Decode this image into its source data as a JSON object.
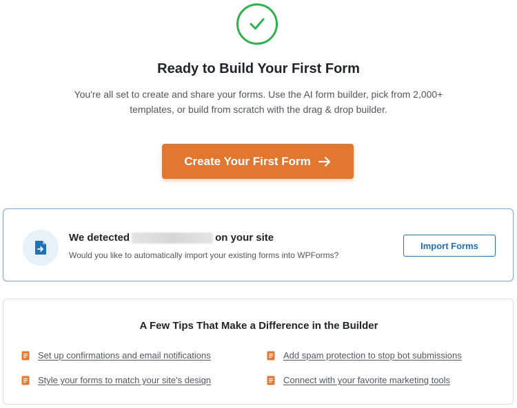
{
  "hero": {
    "icon": "checkmark-icon",
    "success_color": "#2bb24c",
    "title": "Ready to Build Your First Form",
    "subtitle": "You're all set to create and share your forms. Use the AI form builder, pick from 2,000+ templates, or build from scratch with the drag & drop builder.",
    "cta_label": "Create Your First Form",
    "cta_icon": "arrow-right-icon",
    "cta_color": "#e27730"
  },
  "import": {
    "icon": "import-file-icon",
    "heading_prefix": "We detected",
    "heading_suffix": "on your site",
    "question": "Would you like to automatically import your existing forms into WPForms?",
    "button_label": "Import Forms",
    "accent_color": "#2271b1"
  },
  "tips": {
    "title": "A Few Tips That Make a Difference in the Builder",
    "icon": "document-icon",
    "icon_color": "#e27730",
    "items": [
      {
        "label": "Set up confirmations and email notifications"
      },
      {
        "label": "Add spam protection to stop bot submissions"
      },
      {
        "label": "Style your forms to match your site's design"
      },
      {
        "label": "Connect with your favorite marketing tools"
      }
    ]
  }
}
